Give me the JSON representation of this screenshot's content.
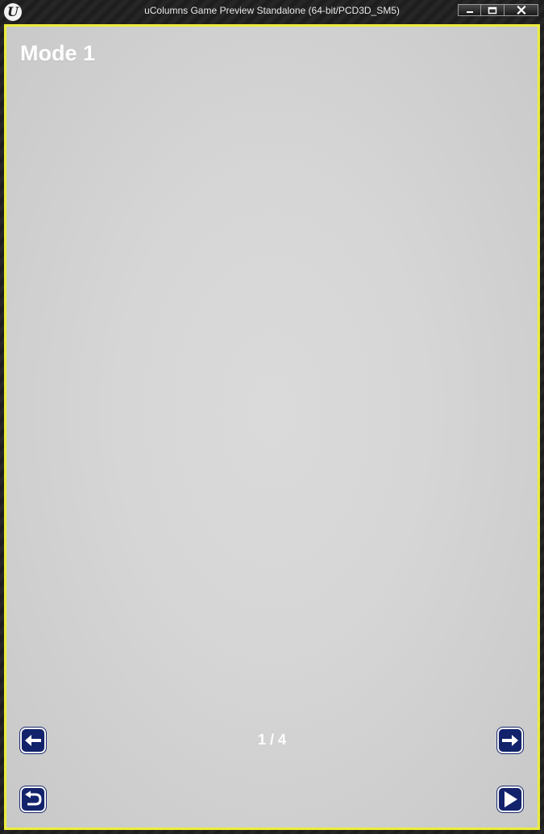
{
  "window": {
    "title": "uColumns Game Preview Standalone (64-bit/PCD3D_SM5)",
    "logo_letter": "U",
    "controls": [
      {
        "name": "minimize-icon"
      },
      {
        "name": "maximize-icon"
      },
      {
        "name": "close-icon"
      }
    ]
  },
  "viewport": {
    "border_color": "#ecec3c",
    "background_color": "#d6d6d6"
  },
  "screen": {
    "mode_title": "Mode 1",
    "page_indicator": "1 / 4"
  },
  "buttons": {
    "prev": {
      "icon": "arrow-left-icon"
    },
    "next": {
      "icon": "arrow-right-icon"
    },
    "back": {
      "icon": "return-icon"
    },
    "play": {
      "icon": "play-icon"
    },
    "color": "#12226b"
  }
}
